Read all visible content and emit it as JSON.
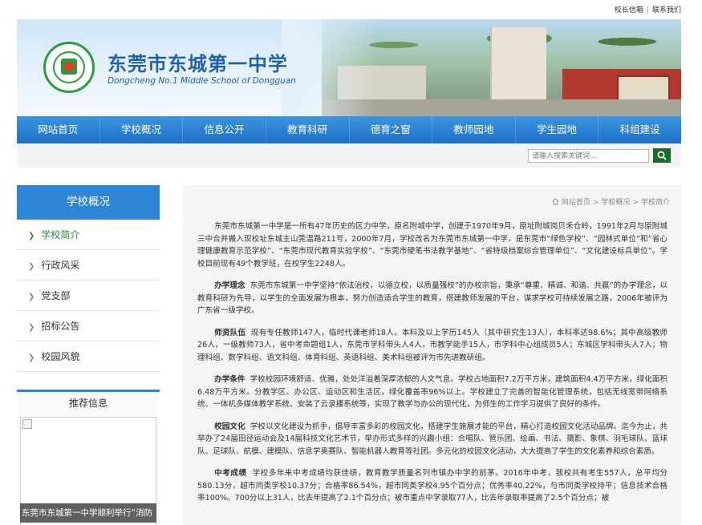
{
  "top_links": {
    "mailbox": "校长信箱",
    "separator": "|",
    "contact": "联系我们"
  },
  "header": {
    "school_name": "东莞市东城第一中学",
    "school_name_en": "Dongcheng No.1 Middle School of Dongguan"
  },
  "nav": {
    "items": [
      "网站首页",
      "学校概况",
      "信息公开",
      "教育科研",
      "德育之窗",
      "教师园地",
      "学生园地",
      "科组建设"
    ]
  },
  "search": {
    "placeholder": "请输入搜索关键词..."
  },
  "sidebar": {
    "title": "学校概况",
    "items": [
      {
        "label": "学校简介",
        "active": true
      },
      {
        "label": "行政风采"
      },
      {
        "label": "党支部"
      },
      {
        "label": "招标公告"
      },
      {
        "label": "校园风貌"
      }
    ],
    "recommend": {
      "title": "推荐信息",
      "caption": "东莞市东城第一中学顺利举行“消防"
    }
  },
  "breadcrumb": {
    "home": "网站首页",
    "section": "学校概况",
    "page": "学校简介",
    "separator": ">"
  },
  "article": {
    "intro": "东莞市东城第一中学是一所有47年历史的区力中学，原名附城中学，创建于1970年9月，原址附城岗贝禾仓岭，1991年2月与原附城三中合并搬入现校址东城主山莞温路211号，2000年7月，学校改名为东莞市东城第一中学，是东莞市“绿色学校”、“园林式单位”和“省心理健康教育示范学校”、“东莞市现代教育实验学校”、“东莞市硬笔书法教学基地”、“省特级档案综合管理单位”、“文化建设标兵单位”。学校目前现有49个教学班，在校学生2248人。",
    "sections": [
      {
        "heading": "办学理念",
        "text": "东莞市东城第一中学坚持“依法治校，以德立校，以质量强校”的办校宗旨，秉承“尊重、精诚、和谐、共赢”的办学理念，以教育科研为先导，以学生的全面发展为根本，努力创造适合学生的教育，搭建教师发展的平台，谋求学校可持续发展之路，2006年被评为广东省一级学校。"
      },
      {
        "heading": "师资队伍",
        "text": "现有专任教师147人，临时代课老师18人，本科及以上学历145人（其中研究生13人），本科率达98.6%；其中高级教师26人，一级教师73人，省中考命题组1人，东莞市学科带头人4人，市教学能手15人，市学科中心组成员5人；东城区学科带头人7人；物理科组、数学科组、语文科组、体育科组、英语科组、美术科组被评为市先进教研组。"
      },
      {
        "heading": "办学条件",
        "text": "学校校园环境舒适、优雅，处处洋溢着深厚浓郁的人文气息。学校占地面积7.2万平方米，建筑面积4.4万平方米，绿化面积6.48万平方米。分教学区、办公区、运动区和生活区，绿化覆盖率96%以上。学校建立了完善的智能化管理系统，包括无线宽带网络系统、一体机多媒体教学系统、安装了云录播系统等，实现了教学与办公的现代化，为师生的工作学习提供了良好的条件。"
      },
      {
        "heading": "校园文化",
        "text": "学校以文化建设为抓手，倡导丰富多彩的校园文化，搭建学生施展才能的平台，精心打造校园文化活动品牌。迄今为止，共举办了24届田径运动会及14届科技文化艺术节，举办形式多样的兴趣小组：合唱队、管乐团、绘画、书法、摄影、象棋、羽毛球队、篮球队、足球队、航模、建模队、信息学奥赛队、智能机器人教育等社团。多元化的校园文化活动，大大提高了学生的文化素养和综合素质。"
      },
      {
        "heading": "中考成绩",
        "text": "学校多年来中考成绩均获佳绩，教育教学质量名列市镇办中学的前茅。2016年中考，我校共有考生557人，总平均分580.13分，超市同类学校10.37分；合格率86.54%，超市同类学校4.95个百分点；优秀率40.22%，与市同类学校持平；信息技术合格率100%。700分以上31人，比去年提高了2.1个百分点；被市重点中学录取77人，比去年录取率提高了2.5个百分点；被"
      }
    ]
  },
  "colors": {
    "nav_blue": "#2e85d6",
    "active_green": "#2b8a3e",
    "search_button": "#1a6a2c",
    "title_blue": "#1d5fb0"
  }
}
